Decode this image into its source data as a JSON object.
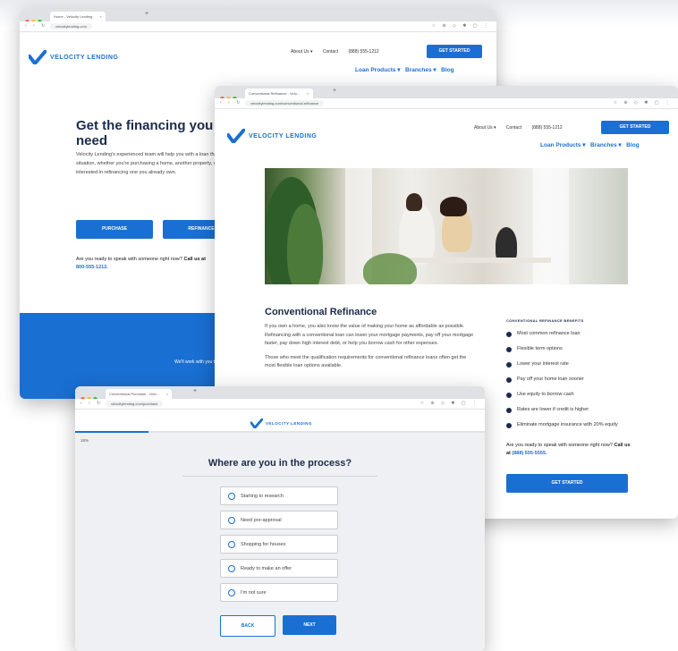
{
  "brand": {
    "name": "VELOCITY LENDING",
    "accent": "#1a6fd3",
    "dark": "#1c2b4a"
  },
  "window1": {
    "tab_title": "Home - Velocity Lending",
    "url": "velocitylending.com",
    "nav_top": [
      "About Us ▾",
      "Contact",
      "(888) 555-1212"
    ],
    "get_started": "GET STARTED",
    "nav_main": [
      "Loan Products ▾",
      "Branches ▾",
      "Blog"
    ],
    "hero_title": "Get the financing you need",
    "hero_text": "Velocity Lending's experienced team will help you with a loan that fits your situation, whether you're purchasing a home, another property, or interested in refinancing one you already own.",
    "btn_purchase": "PURCHASE",
    "btn_refinance": "REFINANCE",
    "callus_text": "Are you ready to speak with someone right now?",
    "callus_bold": "Call us at",
    "callus_phone": "800-555-1212.",
    "band_text": "We'll work with you to whether"
  },
  "window2": {
    "tab_title": "Conventional Refinance - Velo...",
    "url": "velocitylending.com/conventional-refinance",
    "nav_top": [
      "About Us ▾",
      "Contact",
      "(888) 555-1212"
    ],
    "get_started": "GET STARTED",
    "nav_main": [
      "Loan Products ▾",
      "Branches ▾",
      "Blog"
    ],
    "page_title": "Conventional Refinance",
    "para1": "If you own a home, you also know the value of making your home as affordable as possible. Refinancing with a conventional loan can lower your mortgage payments, pay off your mortgage faster, pay down high interest debt, or help you borrow cash for other expenses.",
    "para2": "Those who meet the qualification requirements for conventional refinance loans often get the most flexible loan options available.",
    "benefits_title": "CONVENTIONAL REFINANCE BENEFITS",
    "benefits": [
      "Most common refinance loan",
      "Flexible term options",
      "Lower your interest rate",
      "Pay off your home loan sooner",
      "Use equity to borrow cash",
      "Rates are lower if credit is higher",
      "Eliminate mortgage insurance with 20% equity"
    ],
    "callus_text": "Are you ready to speak with someone right now?",
    "callus_bold": "Call us at",
    "callus_phone": "(888) 555-5555.",
    "cta": "GET STARTED"
  },
  "window3": {
    "tab_title": "Conventional Purchase - Velo...",
    "url": "velocitylending.com/purchase",
    "progress_label": "18%",
    "progress_value": 0.18,
    "question": "Where are you in the process?",
    "options": [
      "Starting to research",
      "Need pre-approval",
      "Shopping for houses",
      "Ready to make an offer",
      "I'm not sure"
    ],
    "back": "BACK",
    "next": "NEXT"
  }
}
